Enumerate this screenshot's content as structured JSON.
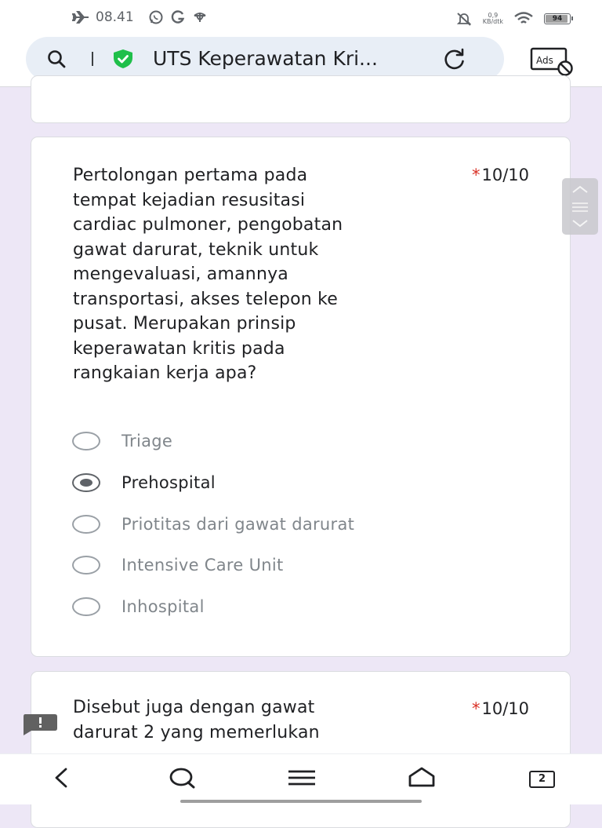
{
  "status_bar": {
    "time": "08.41",
    "net_speed": "0,9",
    "net_unit": "KB/dtk",
    "battery": 94,
    "battery_label": "94"
  },
  "browser": {
    "page_title": "UTS Keperawatan Kri...",
    "ads_label": "Ads"
  },
  "questions": [
    {
      "text": "Pertolongan pertama pada\ntempat kejadian resusitasi\ncardiac pulmoner, pengobatan\ngawat darurat, teknik untuk\nmengevaluasi, amannya\ntransportasi, akses telepon ke\npusat. Merupakan prinsip\nkeperawatan kritis pada\nrangkaian kerja apa?",
      "required_mark": "*",
      "points": "10/10",
      "selected": "Prehospital",
      "options": [
        "Triage",
        "Prehospital",
        "Priotitas dari gawat darurat",
        "Intensive Care Unit",
        "Inhospital"
      ]
    },
    {
      "text": "Disebut juga dengan gawat\ndarurat 2 yang memerlukan",
      "required_mark": "*",
      "points": "10/10"
    }
  ],
  "nav": {
    "tab_count": "2"
  },
  "colors": {
    "page_background": "#ede7f6",
    "required": "#d93025",
    "shield": "#1fbf4a"
  },
  "icons": [
    "airplane-icon",
    "whatsapp-icon",
    "google-icon",
    "app-icon",
    "mute-icon",
    "wifi-icon",
    "battery-icon",
    "search-icon",
    "shield-icon",
    "reload-icon",
    "ads-block-icon",
    "feedback-icon",
    "back-icon",
    "menu-icon",
    "home-icon",
    "tabs-icon"
  ]
}
